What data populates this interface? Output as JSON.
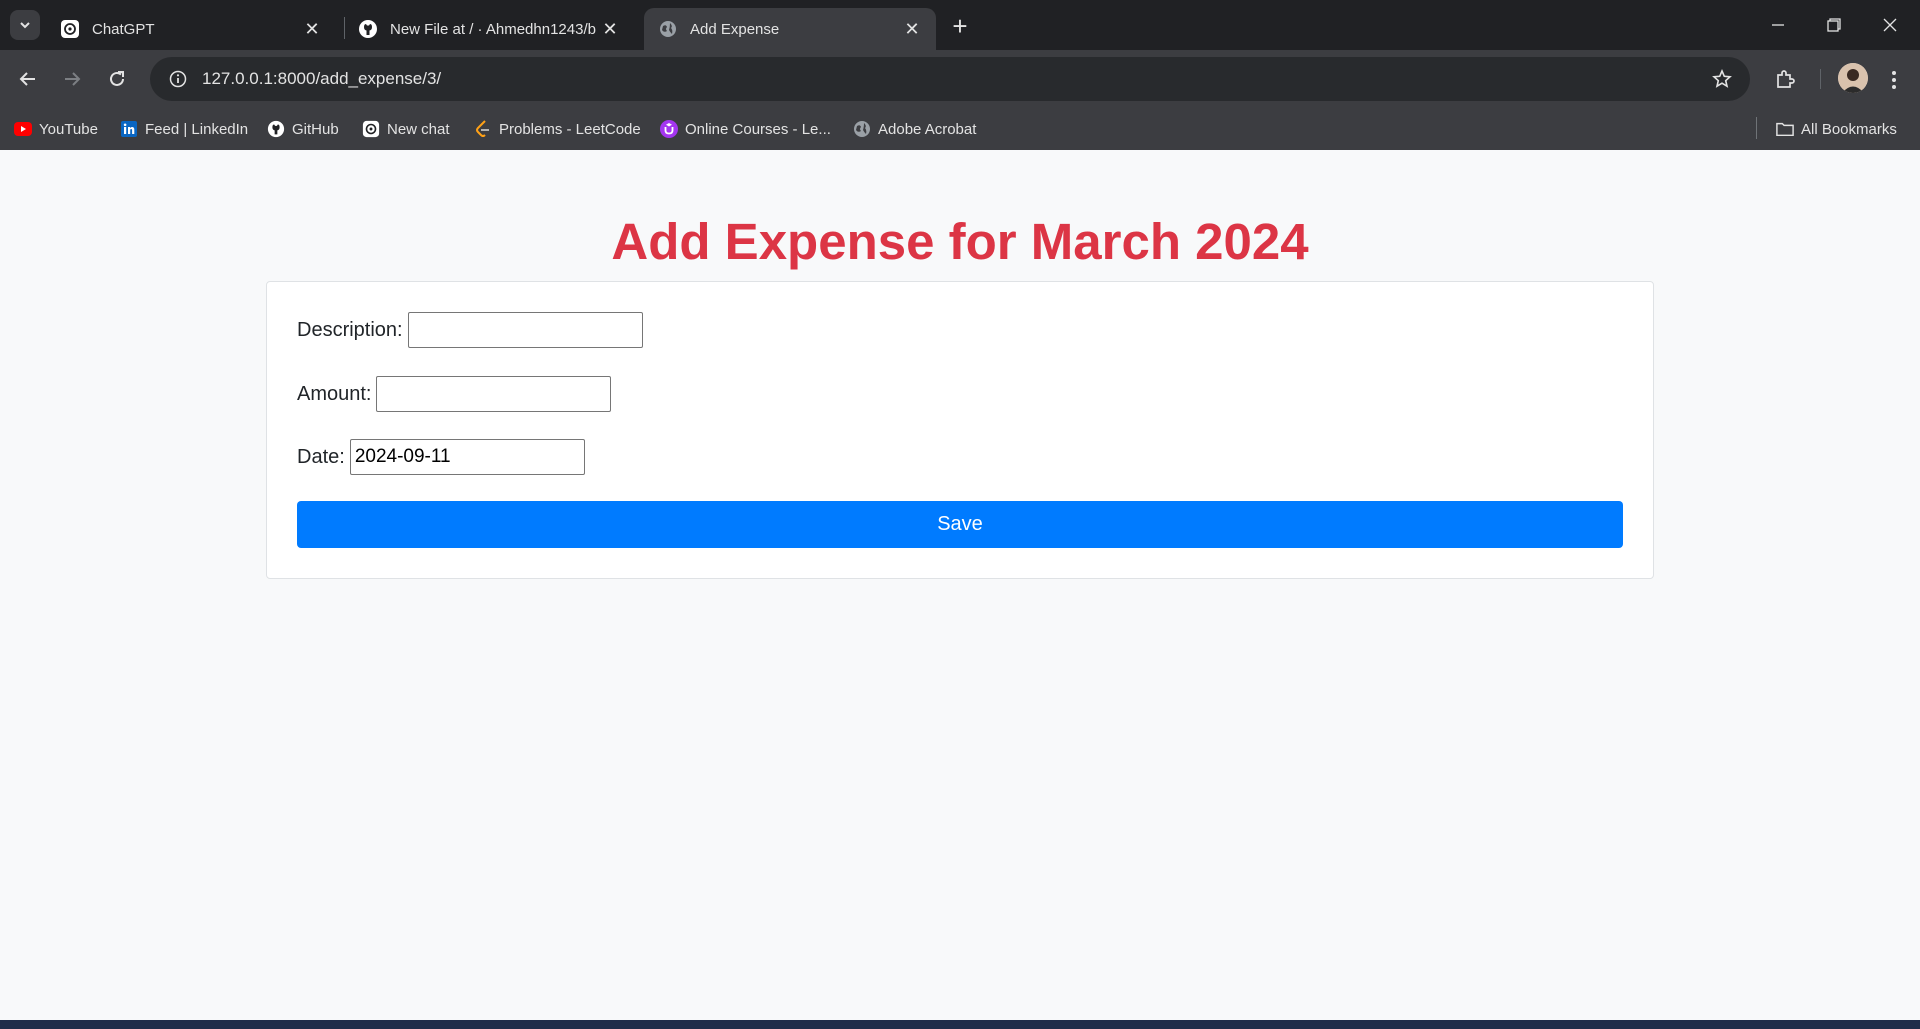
{
  "browser": {
    "tabs": [
      {
        "title": "ChatGPT",
        "icon": "openai-icon",
        "active": false
      },
      {
        "title": "New File at / · Ahmedhn1243/b",
        "icon": "github-icon",
        "active": false
      },
      {
        "title": "Add Expense",
        "icon": "globe-icon",
        "active": true
      }
    ],
    "url": "127.0.0.1:8000/add_expense/3/",
    "bookmarks": [
      {
        "label": "YouTube",
        "icon": "youtube-icon"
      },
      {
        "label": "Feed | LinkedIn",
        "icon": "linkedin-icon"
      },
      {
        "label": "GitHub",
        "icon": "github-icon"
      },
      {
        "label": "New chat",
        "icon": "openai-icon"
      },
      {
        "label": "Problems - LeetCode",
        "icon": "leetcode-icon"
      },
      {
        "label": "Online Courses - Le...",
        "icon": "udemy-icon"
      },
      {
        "label": "Adobe Acrobat",
        "icon": "globe-icon"
      }
    ],
    "all_bookmarks_label": "All Bookmarks"
  },
  "page": {
    "title": "Add Expense for March 2024",
    "form": {
      "description_label": "Description:",
      "description_value": "",
      "amount_label": "Amount:",
      "amount_value": "",
      "date_label": "Date:",
      "date_value": "2024-09-11",
      "save_label": "Save"
    }
  },
  "colors": {
    "title": "#dc3545",
    "save_button": "#007bff",
    "page_background": "#f8f9fa",
    "chrome_dark": "#202124",
    "chrome_toolbar": "#3c3d41"
  }
}
